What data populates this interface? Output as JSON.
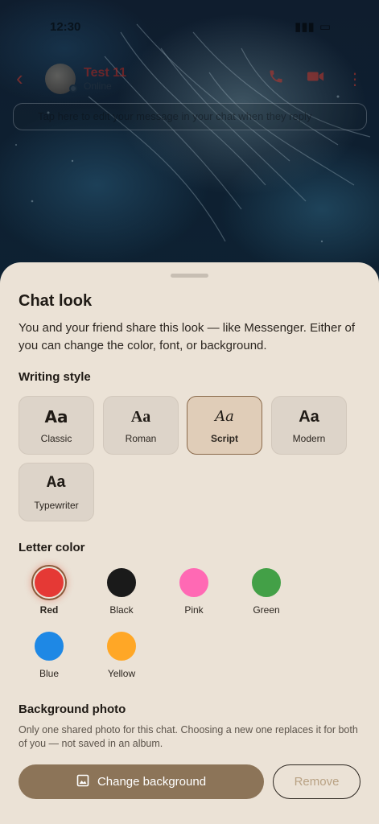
{
  "status_bar": {
    "time": "12:30",
    "signal": "▮▮▮",
    "battery": "▭"
  },
  "chat_header": {
    "back_glyph": "‹",
    "contact_name": "Test 11",
    "contact_sub": "Online",
    "call_icon": "phone-icon",
    "video_icon": "video-icon"
  },
  "search_hint": "Tap here to edit your message in your chat when they reply",
  "sheet": {
    "title": "Chat look",
    "description": "You and your friend share this look — like Messenger. Either of you can change the color, font, or background.",
    "writing_style": {
      "label": "Writing style",
      "options": [
        {
          "sample": "Aa",
          "name": "Classic",
          "selected": false
        },
        {
          "sample": "Aa",
          "name": "Roman",
          "selected": false
        },
        {
          "sample": "Aa",
          "name": "Script",
          "selected": true
        },
        {
          "sample": "Aa",
          "name": "Modern",
          "selected": false
        },
        {
          "sample": "Aa",
          "name": "Typewriter",
          "selected": false
        }
      ]
    },
    "letter_color": {
      "label": "Letter color",
      "options": [
        {
          "name": "Red",
          "color": "#e53935",
          "selected": true
        },
        {
          "name": "Black",
          "color": "#1a1a1a",
          "selected": false
        },
        {
          "name": "Pink",
          "color": "#ff69b4",
          "selected": false
        },
        {
          "name": "Green",
          "color": "#43a047",
          "selected": false
        },
        {
          "name": "Blue",
          "color": "#1e88e5",
          "selected": false
        },
        {
          "name": "Yellow",
          "color": "#ffa726",
          "selected": false
        }
      ]
    },
    "background_photo": {
      "label": "Background photo",
      "description": "Only one shared photo for this chat. Choosing a new one replaces it for both of you — not saved in an album.",
      "change_button": "Change background",
      "remove_button": "Remove"
    }
  },
  "colors": {
    "sheet_bg": "#ebe2d6",
    "accent_brown": "#8c7458",
    "header_red": "#c4352a"
  }
}
